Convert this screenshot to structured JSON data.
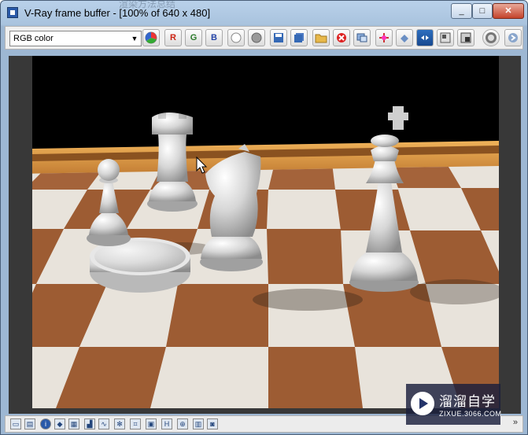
{
  "window": {
    "title": "V-Ray frame buffer - [100% of 640 x 480]",
    "title_bg_text": "渲染方法总结",
    "buttons": {
      "minimize": "_",
      "maximize": "□",
      "close": "✕"
    }
  },
  "toolbar": {
    "channel_selected": "RGB color",
    "channel_label_r": "R",
    "channel_label_g": "G",
    "channel_label_b": "B",
    "icons": [
      "color-picker-icon",
      "red-channel-icon",
      "green-channel-icon",
      "blue-channel-icon",
      "white-sphere-icon",
      "grey-sphere-icon",
      "save-icon",
      "save-all-icon",
      "open-folder-icon",
      "clear-icon",
      "duplicate-icon",
      "track-mouse-icon",
      "region-render-icon",
      "pixel-info-icon",
      "color-correction-icon",
      "lut-icon",
      "stop-render-icon",
      "more-icon"
    ]
  },
  "status": {
    "chevron": "»",
    "icons": [
      "window-icon",
      "table-icon",
      "info-icon",
      "color-icon",
      "gamma-icon",
      "levels-icon",
      "curves-icon",
      "lens-icon",
      "history-icon",
      "exposure-icon",
      "hsl-icon",
      "balance-icon",
      "compare-icon",
      "filter-icon"
    ]
  },
  "watermark": {
    "title": "溜溜自学",
    "url": "ZIXUE.3066.COM"
  },
  "colors": {
    "titlebar": "#b3cbe5",
    "toolbar": "#f0f0f0",
    "board_light": "#e9e4dc",
    "board_dark": "#9b5b34",
    "piece": "#d9d9d9"
  }
}
